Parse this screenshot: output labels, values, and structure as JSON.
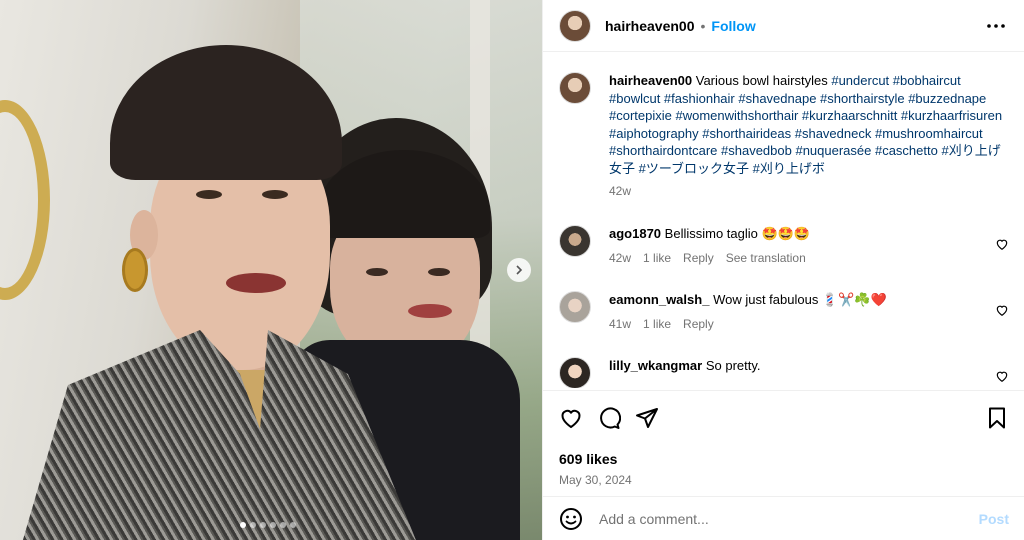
{
  "post": {
    "username": "hairheaven00",
    "separator": "•",
    "follow_label": "Follow"
  },
  "caption": {
    "username": "hairheaven00",
    "text": "Various bowl hairstyles",
    "hashtags": "#undercut #bobhaircut #bowlcut #fashionhair #shavednape #shorthairstyle #buzzednape #cortepixie #womenwithshorthair #kurzhaarschnitt #kurzhaarfrisuren #aiphotography #shorthairideas #shavedneck #mushroomhaircut #shorthairdontcare #shavedbob #nuquerasée #caschetto #刈り上げ女子 #ツーブロック女子 #刈り上げボ",
    "time": "42w"
  },
  "comments": [
    {
      "username": "ago1870",
      "text": "Bellissimo taglio 🤩🤩🤩",
      "time": "42w",
      "likes": "1 like",
      "reply": "Reply",
      "translate": "See translation"
    },
    {
      "username": "eamonn_walsh_",
      "text": "Wow just fabulous 💈✂️☘️❤️",
      "time": "41w",
      "likes": "1 like",
      "reply": "Reply"
    },
    {
      "username": "lilly_wkangmar",
      "text": "So pretty."
    }
  ],
  "likes": "609 likes",
  "date": "May 30, 2024",
  "add_comment": {
    "placeholder": "Add a comment...",
    "post_label": "Post"
  },
  "carousel": {
    "slides": 6,
    "active_index": 0
  },
  "colors": {
    "accent": "#0095f6",
    "hashtag": "#00376b",
    "muted": "#737373",
    "post_disabled": "#b3dbff"
  },
  "icons": [
    "more-icon",
    "next-slide-icon",
    "heart-icon",
    "comment-icon",
    "share-icon",
    "bookmark-icon",
    "emoji-icon"
  ]
}
